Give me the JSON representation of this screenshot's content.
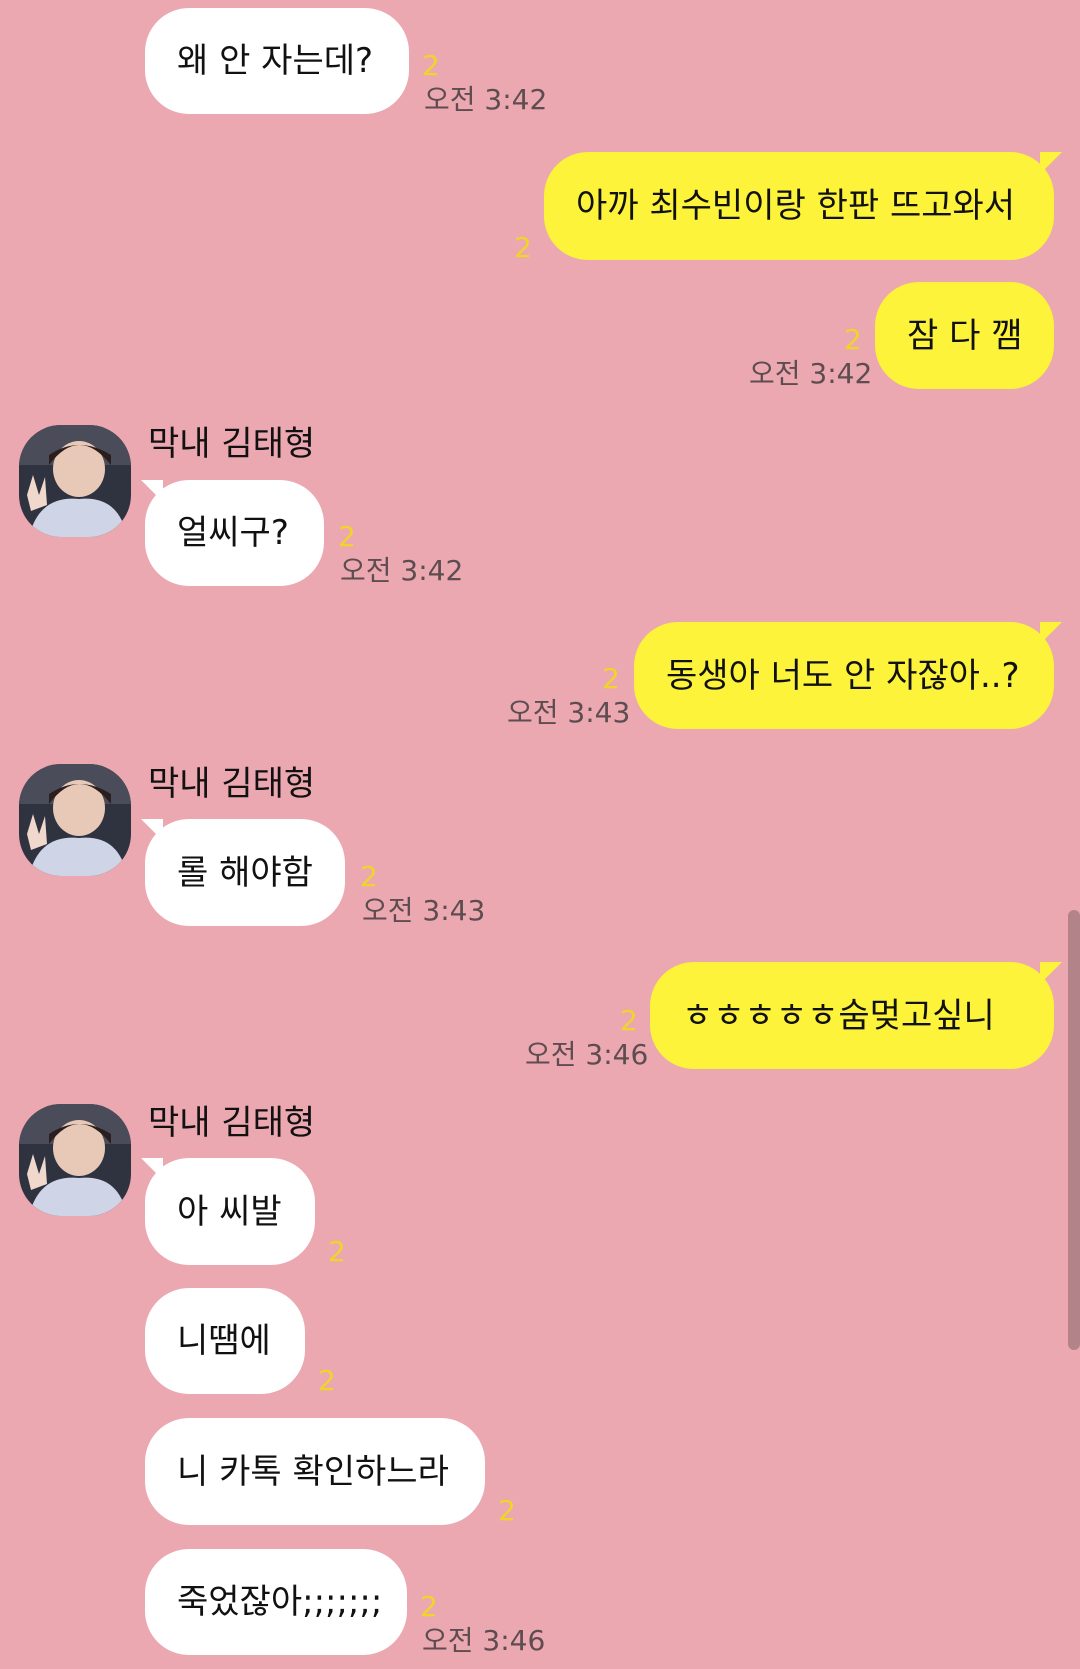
{
  "chat": {
    "sender_name": "막내 김태형",
    "unread_count": "2",
    "messages": [
      {
        "text": "왜 안 자는데?",
        "time": "오전 3:42"
      },
      {
        "text": "아까 최수빈이랑 한판 뜨고와서"
      },
      {
        "text": "잠 다 깸",
        "time": "오전 3:42"
      },
      {
        "text": "얼씨구?",
        "time": "오전 3:42"
      },
      {
        "text": "동생아 너도 안 자잖아..?",
        "time": "오전 3:43"
      },
      {
        "text": "롤 해야함",
        "time": "오전 3:43"
      },
      {
        "text": "ㅎㅎㅎㅎㅎ숨멎고싶니",
        "time": "오전 3:46"
      },
      {
        "text": "아 씨발"
      },
      {
        "text": "니땜에"
      },
      {
        "text": "니 카톡 확인하느라"
      },
      {
        "text": "죽었잖아;;;;;;;",
        "time": "오전 3:46"
      }
    ]
  },
  "colors": {
    "background": "#eba8b1",
    "incoming_bubble": "#ffffff",
    "outgoing_bubble": "#fcf33a",
    "unread": "#f0d428",
    "time": "#5e4d50"
  }
}
